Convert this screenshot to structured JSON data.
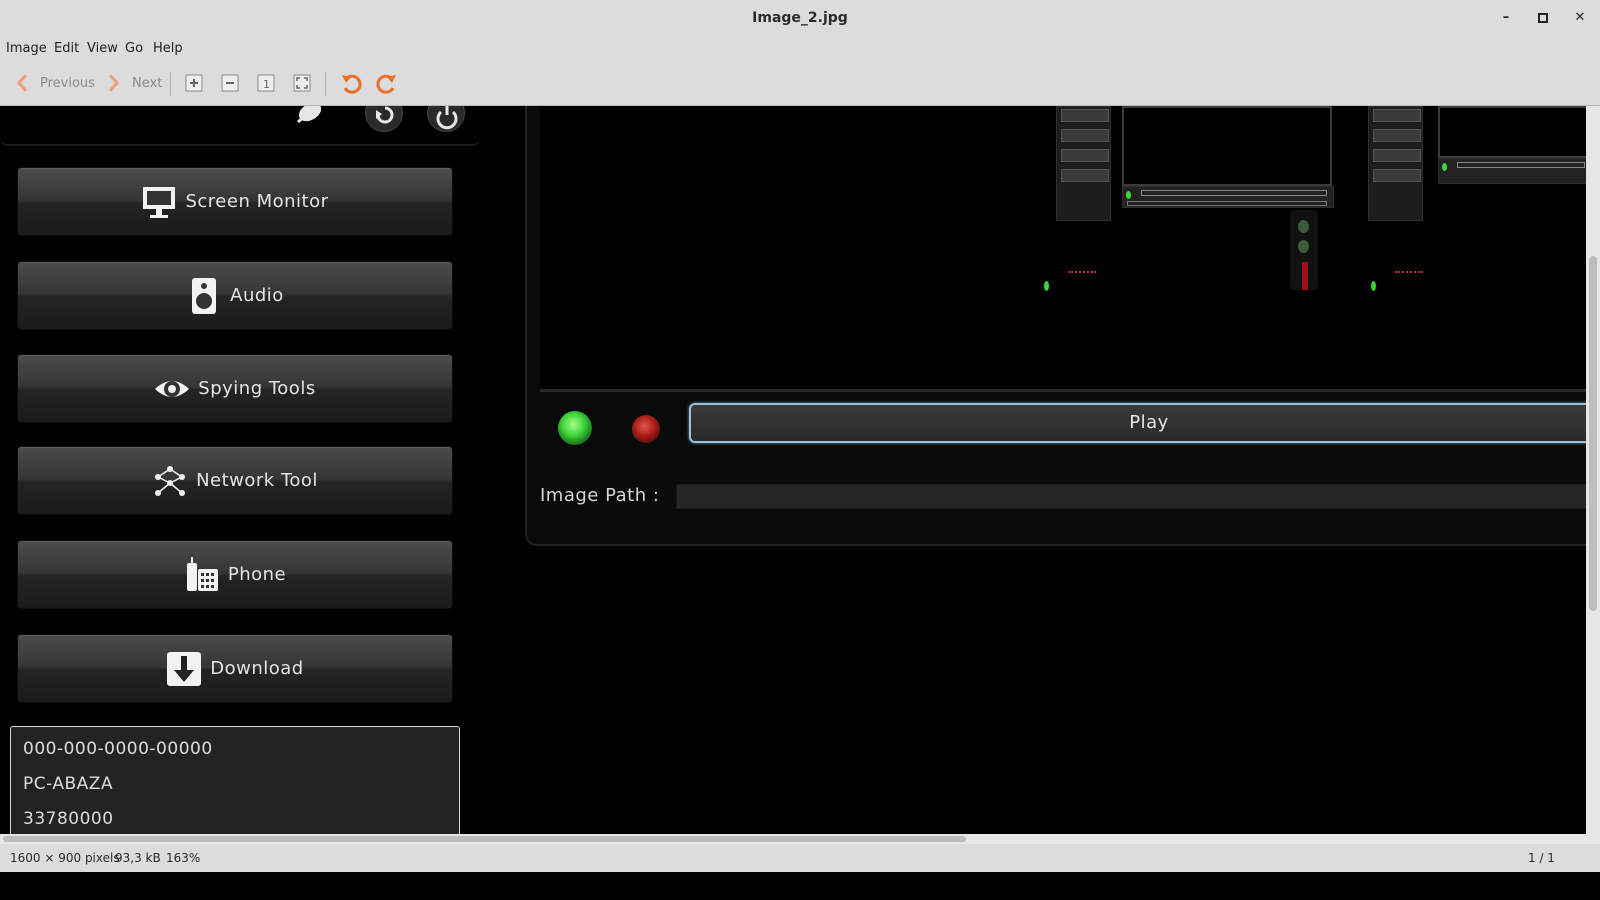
{
  "window": {
    "title": "Image_2.jpg"
  },
  "menubar": [
    "Image",
    "Edit",
    "View",
    "Go",
    "Help"
  ],
  "toolbar": {
    "previous": "Previous",
    "next": "Next"
  },
  "panel": {
    "buttons": [
      {
        "label": "Screen Monitor",
        "icon": "monitor-icon"
      },
      {
        "label": "Audio",
        "icon": "speaker-icon"
      },
      {
        "label": "Spying Tools",
        "icon": "eye-icon"
      },
      {
        "label": "Network Tool",
        "icon": "network-icon"
      },
      {
        "label": "Phone",
        "icon": "phone-icon"
      },
      {
        "label": "Download",
        "icon": "download-icon"
      }
    ],
    "info": [
      "000-000-0000-00000",
      "PC-ABAZA",
      "33780000"
    ]
  },
  "player": {
    "play_label": "Play",
    "image_path_label": "Image Path :",
    "image_path_value": ""
  },
  "status": {
    "dimensions": "1600 × 900 pixels",
    "size": "93,3 kB",
    "zoom": "163%",
    "page": "1 / 1"
  },
  "colors": {
    "accent_orange": "#e8702a",
    "led_green": "#3cd43a",
    "led_red": "#a51d15",
    "play_border": "#9cc3d8"
  }
}
